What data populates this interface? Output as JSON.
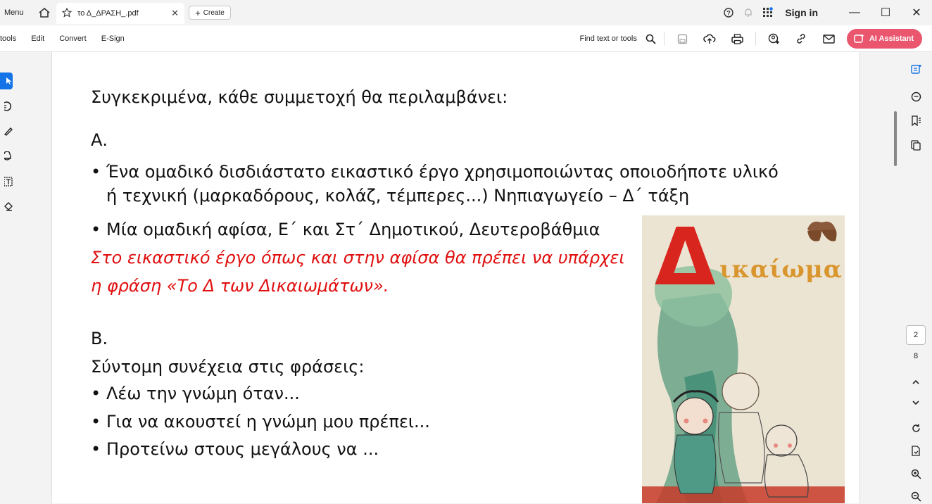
{
  "titlebar": {
    "menu": "Menu",
    "tab_title": "το Δ_ΔΡΑΣΗ_.pdf",
    "create": "Create",
    "sign_in": "Sign in"
  },
  "toolbar": {
    "items": [
      "tools",
      "Edit",
      "Convert",
      "E-Sign"
    ],
    "find": "Find text or tools",
    "ai_assistant": "AI Assistant"
  },
  "document": {
    "heading": "Συγκεκριμένα, κάθε συμμετοχή θα περιλαμβάνει:",
    "section_a": "Α.",
    "bullet_a1_line1": "Ένα ομαδικό δισδιάστατο εικαστικό έργο χρησιμοποιώντας οποιοδήποτε υλικό",
    "bullet_a1_line2": "ή τεχνική (μαρκαδόρους, κολάζ, τέμπερες...) Νηπιαγωγείο – Δ΄ τάξη",
    "bullet_a2": "Μία ομαδική αφίσα, Ε΄ και Στ΄ Δημοτικού, Δευτεροβάθμια",
    "red_line1": "Στο εικαστικό έργο όπως και στην αφίσα θα πρέπει να υπάρχει",
    "red_line2": "η φράση «Το Δ των Δικαιωμάτων».",
    "section_b": "Β.",
    "intro_b": "Σύντομη συνέχεια στις φράσεις:",
    "bullet_b1": "Λέω την γνώμη όταν...",
    "bullet_b2": "Για να ακουστεί η γνώμη μου πρέπει...",
    "bullet_b3": "Προτείνω στους μεγάλους να ...",
    "bullet": "•"
  },
  "illustration": {
    "big_letter": "Δ",
    "word": "ικαίωμα"
  },
  "navigation": {
    "current_page": "2",
    "total_pages": "8"
  },
  "colors": {
    "accent": "#1473e6",
    "ai_button": "#e9566d",
    "red_text": "#e01010"
  }
}
